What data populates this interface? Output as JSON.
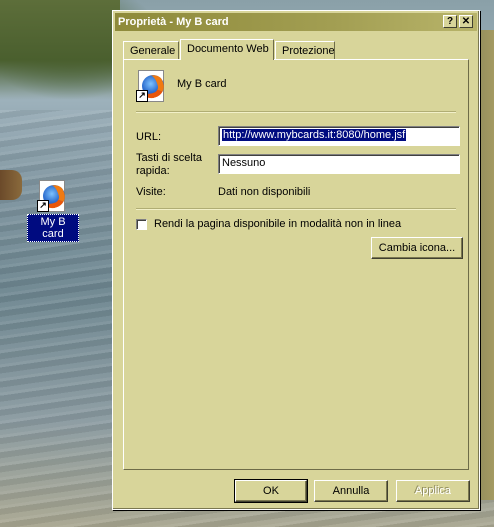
{
  "desktop": {
    "shortcut_label": "My B card",
    "shortcut_icon": "firefox-shortcut-icon"
  },
  "window": {
    "title": "Proprietà - My B card",
    "help_glyph": "?",
    "close_glyph": "✕"
  },
  "tabs": [
    {
      "label": "Generale",
      "active": false
    },
    {
      "label": "Documento Web",
      "active": true
    },
    {
      "label": "Protezione",
      "active": false
    }
  ],
  "panel": {
    "item_name": "My B card",
    "url_label": "URL:",
    "url_value": "http://www.mybcards.it:8080/home.jsf",
    "hotkey_label": "Tasti di scelta rapida:",
    "hotkey_value": "Nessuno",
    "visits_label": "Visite:",
    "visits_value": "Dati non disponibili",
    "offline_label": "Rendi la pagina disponibile in modalità non in linea",
    "offline_checked": false,
    "change_icon_label": "Cambia icona..."
  },
  "buttons": {
    "ok": "OK",
    "cancel": "Annulla",
    "apply": "Applica"
  },
  "colors": {
    "dialog_bg": "#d8d59a",
    "title_bar": "#8e8a3a",
    "selection": "#000b80"
  }
}
